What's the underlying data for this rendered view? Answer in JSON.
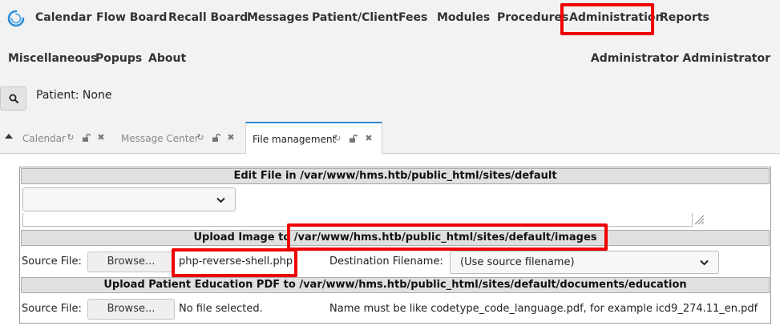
{
  "nav": {
    "primary": [
      "Calendar",
      "Flow Board",
      "Recall Board",
      "Messages",
      "Patient/Client",
      "Fees",
      "Modules",
      "Procedures",
      "Administration",
      "Reports"
    ],
    "secondary": [
      "Miscellaneous",
      "Popups",
      "About"
    ],
    "user": "Administrator Administrator"
  },
  "patient": {
    "label": "Patient: None"
  },
  "tabs": [
    {
      "label": "Calendar"
    },
    {
      "label": "Message Center"
    },
    {
      "label": "File management"
    }
  ],
  "edit_file": {
    "heading": "Edit File in /var/www/hms.htb/public_html/sites/default",
    "selected": ""
  },
  "upload_image": {
    "heading_prefix": "Upload Image to ",
    "heading_path": "/var/www/hms.htb/public_html/sites/default/images",
    "source_label": "Source File:",
    "browse_label": "Browse...",
    "file_name": "php-reverse-shell.php",
    "dest_label": "Destination Filename:",
    "dest_value": "(Use source filename)"
  },
  "upload_pdf": {
    "heading": "Upload Patient Education PDF to /var/www/hms.htb/public_html/sites/default/documents/education",
    "source_label": "Source File:",
    "browse_label": "Browse...",
    "file_name": "No file selected.",
    "hint": "Name must be like codetype_code_language.pdf, for example icd9_274.11_en.pdf"
  },
  "colors": {
    "highlight": "#ee0000",
    "tab_accent": "#2a8bd6",
    "nav_bg": "#f2f2f2"
  },
  "icons": [
    "logo-icon",
    "search-icon",
    "collapse-arrow-icon",
    "refresh-icon",
    "unlock-icon",
    "close-icon",
    "chevron-down-icon",
    "resize-handle-icon"
  ]
}
